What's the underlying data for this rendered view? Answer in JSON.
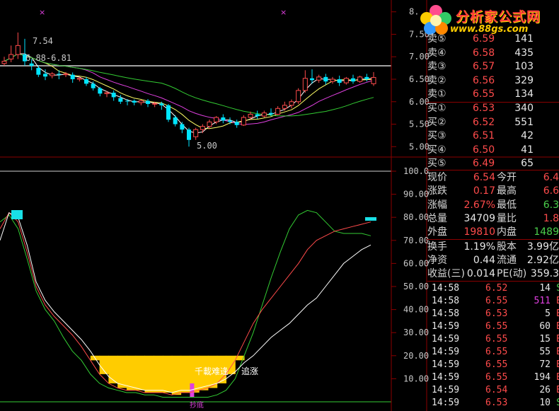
{
  "branding": {
    "title": "分析家公式网",
    "url": "www.88gs.com"
  },
  "price_axis": {
    "ticks": [
      "8.",
      "7.50",
      "7.00",
      "6.50",
      "6.00",
      "5.50",
      "5.00"
    ],
    "annotations": {
      "high": "7.54",
      "range": "6.88-6.81",
      "low": "5.00"
    }
  },
  "indicator_axis": {
    "ticks": [
      "100.0",
      "90.00",
      "80.00",
      "70.00",
      "60.00",
      "50.00",
      "40.00",
      "30.00",
      "20.00",
      "10.00"
    ],
    "signals": {
      "buy": "千載难逢",
      "chase": "追涨",
      "bottom": "抄底"
    }
  },
  "order_book": [
    {
      "label": "卖⑤",
      "price": "6.59",
      "volume": "141"
    },
    {
      "label": "卖④",
      "price": "6.58",
      "volume": "435"
    },
    {
      "label": "卖③",
      "price": "6.57",
      "volume": "103"
    },
    {
      "label": "卖②",
      "price": "6.56",
      "volume": "329"
    },
    {
      "label": "卖①",
      "price": "6.55",
      "volume": "134"
    },
    {
      "label": "买①",
      "price": "6.53",
      "volume": "340"
    },
    {
      "label": "买②",
      "price": "6.52",
      "volume": "551"
    },
    {
      "label": "买③",
      "price": "6.51",
      "volume": "42"
    },
    {
      "label": "买④",
      "price": "6.50",
      "volume": "41"
    },
    {
      "label": "买⑤",
      "price": "6.49",
      "volume": "65"
    }
  ],
  "quote": [
    {
      "l1": "现价",
      "v1": "6.54",
      "l2": "今开",
      "v2": "6.4"
    },
    {
      "l1": "涨跌",
      "v1": "0.17",
      "l2": "最高",
      "v2": "6.6"
    },
    {
      "l1": "涨幅",
      "v1": "2.67%",
      "l2": "最低",
      "v2": "6.3"
    },
    {
      "l1": "总量",
      "v1": "34709",
      "l2": "量比",
      "v2": "1.8"
    },
    {
      "l1": "外盘",
      "v1": "19810",
      "l2": "内盘",
      "v2": "1489"
    }
  ],
  "fundamentals": [
    {
      "l1": "换手",
      "v1": "1.19%",
      "l2": "股本",
      "v2": "3.99亿"
    },
    {
      "l1": "净资",
      "v1": "0.44",
      "l2": "流通",
      "v2": "2.92亿"
    },
    {
      "l1": "收益(三)",
      "v1": "0.014",
      "l2": "PE(动)",
      "v2": "359.3"
    }
  ],
  "ticks": [
    {
      "time": "14:58",
      "price": "6.52",
      "vol": "14",
      "dir": "S"
    },
    {
      "time": "14:58",
      "price": "6.55",
      "vol": "511",
      "dir": "B"
    },
    {
      "time": "14:58",
      "price": "6.53",
      "vol": "5",
      "dir": "B"
    },
    {
      "time": "14:59",
      "price": "6.55",
      "vol": "60",
      "dir": "B"
    },
    {
      "time": "14:59",
      "price": "6.55",
      "vol": "15",
      "dir": "B"
    },
    {
      "time": "14:59",
      "price": "6.55",
      "vol": "55",
      "dir": "B"
    },
    {
      "time": "14:59",
      "price": "6.55",
      "vol": "72",
      "dir": "B"
    },
    {
      "time": "14:59",
      "price": "6.55",
      "vol": "194",
      "dir": "B"
    },
    {
      "time": "14:59",
      "price": "6.54",
      "vol": "26",
      "dir": "B"
    },
    {
      "time": "14:59",
      "price": "6.53",
      "vol": "10",
      "dir": "S"
    }
  ],
  "colors": {
    "up": "#ff4b4b",
    "down": "#4bd04b",
    "bull_candle": "#ff4b4b",
    "bear_candle": "#00e5ff",
    "ma_white": "#ffffff",
    "ma_yellow": "#ffff66",
    "ma_magenta": "#e040e0",
    "ma_green": "#33cc33",
    "fill_gold": "#ffcc00",
    "signal_cyan": "#19e0e6"
  },
  "chart_data": [
    {
      "type": "candlestick",
      "title": "",
      "ylim": [
        4.8,
        8.2
      ],
      "candles": [
        [
          6.85,
          7.0,
          6.9,
          6.8
        ],
        [
          6.95,
          7.25,
          7.05,
          6.88
        ],
        [
          7.05,
          7.54,
          7.25,
          6.95
        ],
        [
          7.05,
          7.4,
          6.9,
          6.8
        ],
        [
          6.85,
          6.95,
          6.8,
          6.7
        ],
        [
          6.75,
          6.8,
          6.6,
          6.55
        ],
        [
          6.62,
          6.72,
          6.56,
          6.48
        ],
        [
          6.58,
          6.66,
          6.62,
          6.52
        ],
        [
          6.62,
          6.7,
          6.6,
          6.5
        ],
        [
          6.6,
          6.66,
          6.62,
          6.55
        ],
        [
          6.6,
          6.65,
          6.5,
          6.42
        ],
        [
          6.5,
          6.55,
          6.52,
          6.45
        ],
        [
          6.5,
          6.55,
          6.4,
          6.35
        ],
        [
          6.4,
          6.45,
          6.3,
          6.25
        ],
        [
          6.3,
          6.33,
          6.18,
          6.12
        ],
        [
          6.18,
          6.24,
          6.2,
          6.1
        ],
        [
          6.2,
          6.25,
          6.1,
          6.02
        ],
        [
          6.08,
          6.15,
          6.0,
          5.95
        ],
        [
          6.02,
          6.06,
          6.01,
          5.92
        ],
        [
          6.02,
          6.05,
          5.98,
          5.92
        ],
        [
          5.98,
          6.04,
          6.02,
          5.92
        ],
        [
          6.02,
          6.06,
          5.95,
          5.88
        ],
        [
          5.95,
          6.0,
          5.96,
          5.88
        ],
        [
          5.96,
          6.0,
          5.92,
          5.82
        ],
        [
          5.92,
          5.95,
          5.6,
          5.55
        ],
        [
          5.65,
          5.7,
          5.5,
          5.45
        ],
        [
          5.5,
          5.55,
          5.38,
          5.3
        ],
        [
          5.38,
          5.42,
          5.15,
          5.0
        ],
        [
          5.22,
          5.42,
          5.38,
          5.15
        ],
        [
          5.38,
          5.5,
          5.45,
          5.3
        ],
        [
          5.45,
          5.6,
          5.55,
          5.4
        ],
        [
          5.55,
          5.68,
          5.65,
          5.5
        ],
        [
          5.65,
          5.72,
          5.58,
          5.52
        ],
        [
          5.58,
          5.65,
          5.55,
          5.5
        ],
        [
          5.55,
          5.6,
          5.48,
          5.42
        ],
        [
          5.48,
          5.7,
          5.65,
          5.46
        ],
        [
          5.65,
          5.78,
          5.72,
          5.6
        ],
        [
          5.72,
          5.8,
          5.68,
          5.62
        ],
        [
          5.68,
          5.8,
          5.75,
          5.65
        ],
        [
          5.75,
          5.85,
          5.72,
          5.68
        ],
        [
          5.72,
          5.9,
          5.85,
          5.7
        ],
        [
          5.85,
          6.0,
          5.92,
          5.8
        ],
        [
          5.92,
          6.05,
          6.0,
          5.85
        ],
        [
          6.0,
          6.3,
          6.25,
          5.95
        ],
        [
          6.25,
          6.7,
          6.52,
          6.2
        ],
        [
          6.52,
          6.72,
          6.48,
          6.4
        ],
        [
          6.48,
          6.6,
          6.55,
          6.42
        ],
        [
          6.55,
          6.62,
          6.45,
          6.38
        ],
        [
          6.45,
          6.55,
          6.5,
          6.4
        ],
        [
          6.5,
          6.58,
          6.42,
          6.35
        ],
        [
          6.42,
          6.55,
          6.52,
          6.38
        ],
        [
          6.52,
          6.6,
          6.45,
          6.4
        ],
        [
          6.45,
          6.58,
          6.55,
          6.42
        ],
        [
          6.55,
          6.62,
          6.5,
          6.45
        ],
        [
          6.4,
          6.66,
          6.54,
          6.35
        ]
      ]
    },
    {
      "type": "line",
      "title": "",
      "ylim": [
        0,
        100
      ],
      "series": [
        {
          "values": [
            78,
            81,
            75,
            62,
            48,
            40,
            35,
            28,
            22,
            18,
            12,
            8,
            6,
            5,
            4,
            4,
            3,
            3,
            2,
            2,
            2,
            2,
            2,
            2,
            3,
            5,
            10,
            20,
            30,
            42,
            54,
            65,
            75,
            81,
            83,
            82,
            78,
            74,
            73,
            73,
            73,
            72
          ]
        },
        {
          "values": [
            75,
            82,
            78,
            65,
            50,
            42,
            37,
            33,
            29,
            24,
            18,
            12,
            8,
            6,
            5,
            5,
            4,
            4,
            4,
            3,
            4,
            4,
            5,
            6,
            8,
            12,
            18,
            26,
            34,
            40,
            45,
            50,
            55,
            60,
            66,
            70,
            72,
            74,
            75,
            76,
            77,
            78
          ]
        },
        {
          "values": [
            70,
            82,
            80,
            68,
            52,
            44,
            39,
            35,
            31,
            27,
            22,
            16,
            11,
            8,
            7,
            6,
            5,
            5,
            5,
            4,
            5,
            5,
            6,
            7,
            8,
            10,
            13,
            17,
            20,
            24,
            28,
            31,
            34,
            38,
            42,
            45,
            50,
            55,
            60,
            63,
            66,
            68
          ]
        }
      ]
    }
  ]
}
